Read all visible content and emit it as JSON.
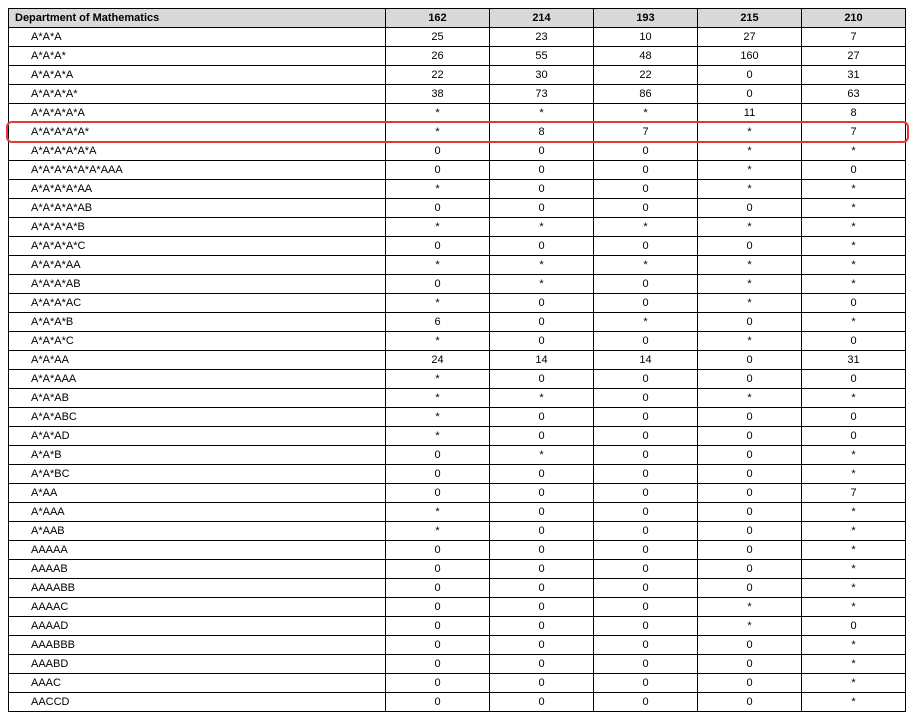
{
  "header": {
    "title": "Department of Mathematics",
    "cols": [
      "162",
      "214",
      "193",
      "215",
      "210"
    ]
  },
  "highlight_row_index": 5,
  "rows": [
    {
      "label": "A*A*A",
      "v": [
        "25",
        "23",
        "10",
        "27",
        "7"
      ]
    },
    {
      "label": "A*A*A*",
      "v": [
        "26",
        "55",
        "48",
        "160",
        "27"
      ]
    },
    {
      "label": "A*A*A*A",
      "v": [
        "22",
        "30",
        "22",
        "0",
        "31"
      ]
    },
    {
      "label": "A*A*A*A*",
      "v": [
        "38",
        "73",
        "86",
        "0",
        "63"
      ]
    },
    {
      "label": "A*A*A*A*A",
      "v": [
        "*",
        "*",
        "*",
        "11",
        "8"
      ]
    },
    {
      "label": "A*A*A*A*A*",
      "v": [
        "*",
        "8",
        "7",
        "*",
        "7"
      ]
    },
    {
      "label": "A*A*A*A*A*A",
      "v": [
        "0",
        "0",
        "0",
        "*",
        "*"
      ]
    },
    {
      "label": "A*A*A*A*A*A*AAA",
      "v": [
        "0",
        "0",
        "0",
        "*",
        "0"
      ]
    },
    {
      "label": "A*A*A*A*AA",
      "v": [
        "*",
        "0",
        "0",
        "*",
        "*"
      ]
    },
    {
      "label": "A*A*A*A*AB",
      "v": [
        "0",
        "0",
        "0",
        "0",
        "*"
      ]
    },
    {
      "label": "A*A*A*A*B",
      "v": [
        "*",
        "*",
        "*",
        "*",
        "*"
      ]
    },
    {
      "label": "A*A*A*A*C",
      "v": [
        "0",
        "0",
        "0",
        "0",
        "*"
      ]
    },
    {
      "label": "A*A*A*AA",
      "v": [
        "*",
        "*",
        "*",
        "*",
        "*"
      ]
    },
    {
      "label": "A*A*A*AB",
      "v": [
        "0",
        "*",
        "0",
        "*",
        "*"
      ]
    },
    {
      "label": "A*A*A*AC",
      "v": [
        "*",
        "0",
        "0",
        "*",
        "0"
      ]
    },
    {
      "label": "A*A*A*B",
      "v": [
        "6",
        "0",
        "*",
        "0",
        "*"
      ]
    },
    {
      "label": "A*A*A*C",
      "v": [
        "*",
        "0",
        "0",
        "*",
        "0"
      ]
    },
    {
      "label": "A*A*AA",
      "v": [
        "24",
        "14",
        "14",
        "0",
        "31"
      ]
    },
    {
      "label": "A*A*AAA",
      "v": [
        "*",
        "0",
        "0",
        "0",
        "0"
      ]
    },
    {
      "label": "A*A*AB",
      "v": [
        "*",
        "*",
        "0",
        "*",
        "*"
      ]
    },
    {
      "label": "A*A*ABC",
      "v": [
        "*",
        "0",
        "0",
        "0",
        "0"
      ]
    },
    {
      "label": "A*A*AD",
      "v": [
        "*",
        "0",
        "0",
        "0",
        "0"
      ]
    },
    {
      "label": "A*A*B",
      "v": [
        "0",
        "*",
        "0",
        "0",
        "*"
      ]
    },
    {
      "label": "A*A*BC",
      "v": [
        "0",
        "0",
        "0",
        "0",
        "*"
      ]
    },
    {
      "label": "A*AA",
      "v": [
        "0",
        "0",
        "0",
        "0",
        "7"
      ]
    },
    {
      "label": "A*AAA",
      "v": [
        "*",
        "0",
        "0",
        "0",
        "*"
      ]
    },
    {
      "label": "A*AAB",
      "v": [
        "*",
        "0",
        "0",
        "0",
        "*"
      ]
    },
    {
      "label": "AAAAA",
      "v": [
        "0",
        "0",
        "0",
        "0",
        "*"
      ]
    },
    {
      "label": "AAAAB",
      "v": [
        "0",
        "0",
        "0",
        "0",
        "*"
      ]
    },
    {
      "label": "AAAABB",
      "v": [
        "0",
        "0",
        "0",
        "0",
        "*"
      ]
    },
    {
      "label": "AAAAC",
      "v": [
        "0",
        "0",
        "0",
        "*",
        "*"
      ]
    },
    {
      "label": "AAAAD",
      "v": [
        "0",
        "0",
        "0",
        "*",
        "0"
      ]
    },
    {
      "label": "AAABBB",
      "v": [
        "0",
        "0",
        "0",
        "0",
        "*"
      ]
    },
    {
      "label": "AAABD",
      "v": [
        "0",
        "0",
        "0",
        "0",
        "*"
      ]
    },
    {
      "label": "AAAC",
      "v": [
        "0",
        "0",
        "0",
        "0",
        "*"
      ]
    },
    {
      "label": "AACCD",
      "v": [
        "0",
        "0",
        "0",
        "0",
        "*"
      ]
    }
  ]
}
